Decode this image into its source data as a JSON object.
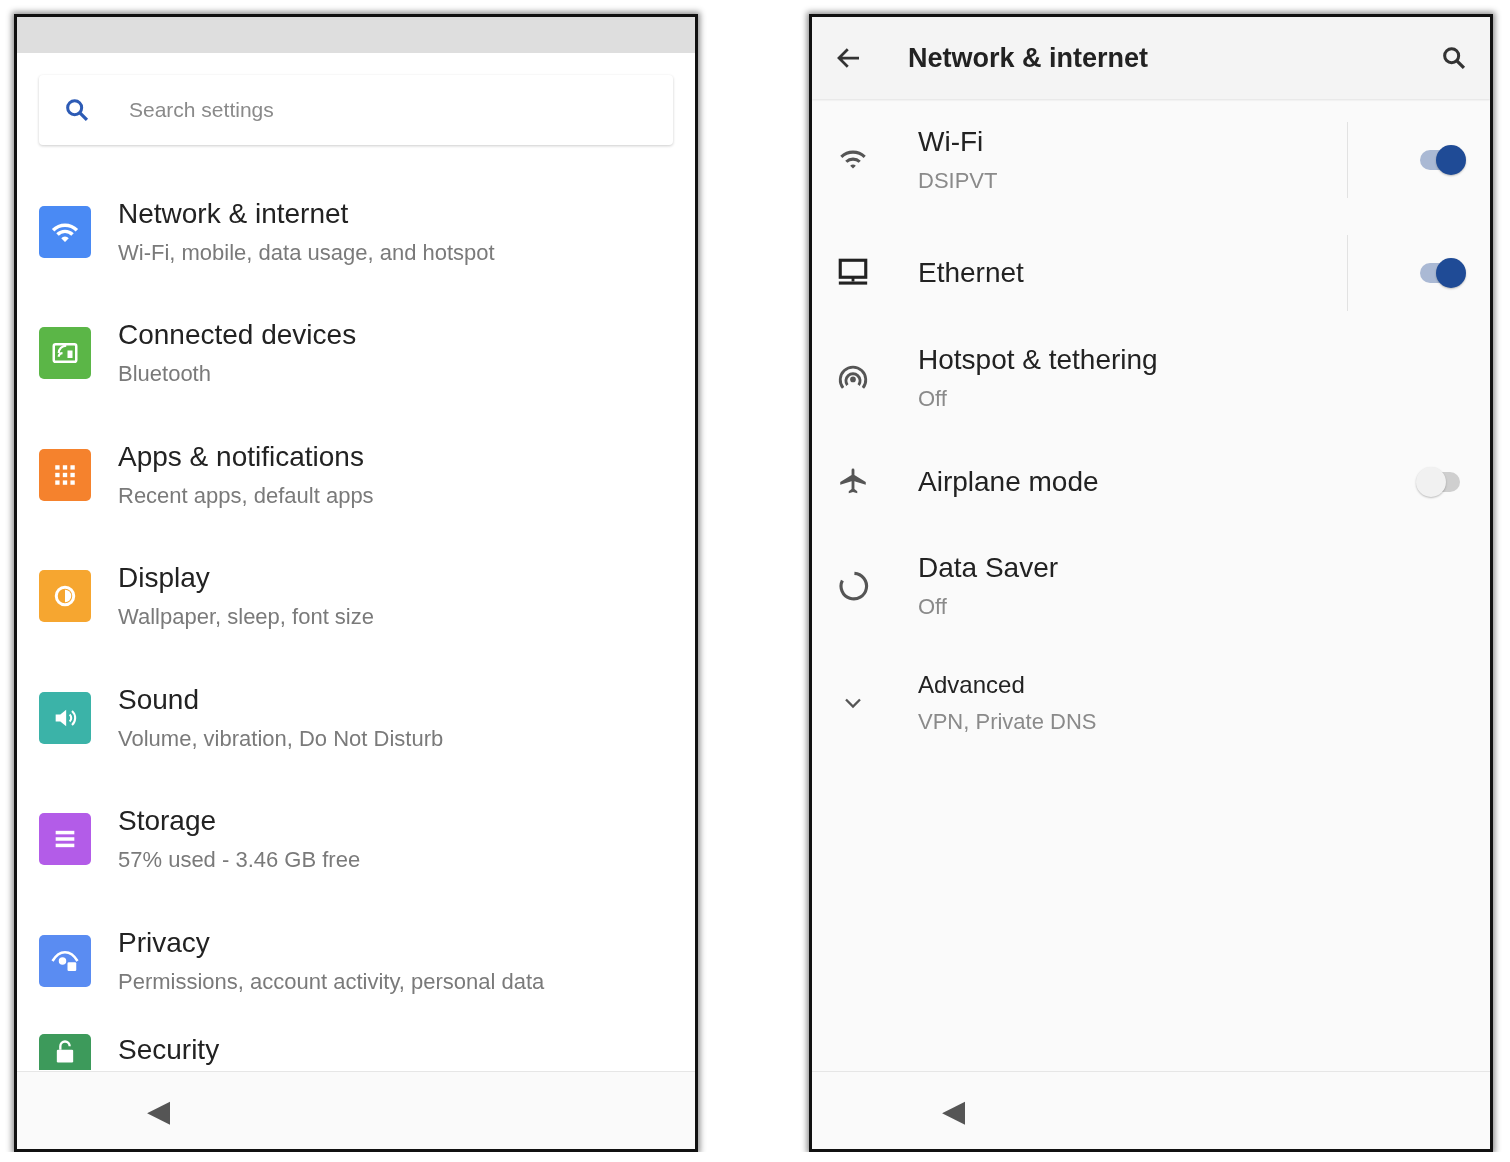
{
  "settings_screen": {
    "search": {
      "placeholder": "Search settings"
    },
    "items": [
      {
        "title": "Network & internet",
        "subtitle": "Wi-Fi, mobile, data usage, and hotspot",
        "color": "#4a8af4"
      },
      {
        "title": "Connected devices",
        "subtitle": "Bluetooth",
        "color": "#5bb647"
      },
      {
        "title": "Apps & notifications",
        "subtitle": "Recent apps, default apps",
        "color": "#f5822d"
      },
      {
        "title": "Display",
        "subtitle": "Wallpaper, sleep, font size",
        "color": "#f6a630"
      },
      {
        "title": "Sound",
        "subtitle": "Volume, vibration, Do Not Disturb",
        "color": "#3bb3a8"
      },
      {
        "title": "Storage",
        "subtitle": "57% used - 3.46 GB free",
        "color": "#b35ce8"
      },
      {
        "title": "Privacy",
        "subtitle": "Permissions, account activity, personal data",
        "color": "#5a8cf2"
      },
      {
        "title": "Security",
        "color": "#3d9a5b"
      }
    ],
    "nav_back": "◀"
  },
  "network_screen": {
    "title": "Network & internet",
    "items": [
      {
        "kind": "split_switch",
        "title": "Wi-Fi",
        "subtitle": "DSIPVT",
        "on": true
      },
      {
        "kind": "split_switch",
        "title": "Ethernet",
        "on": true
      },
      {
        "kind": "plain",
        "title": "Hotspot & tethering",
        "subtitle": "Off"
      },
      {
        "kind": "switch",
        "title": "Airplane mode",
        "on": false
      },
      {
        "kind": "plain",
        "title": "Data Saver",
        "subtitle": "Off"
      },
      {
        "kind": "expand",
        "title": "Advanced",
        "subtitle": "VPN, Private DNS"
      }
    ],
    "nav_back": "◀"
  }
}
